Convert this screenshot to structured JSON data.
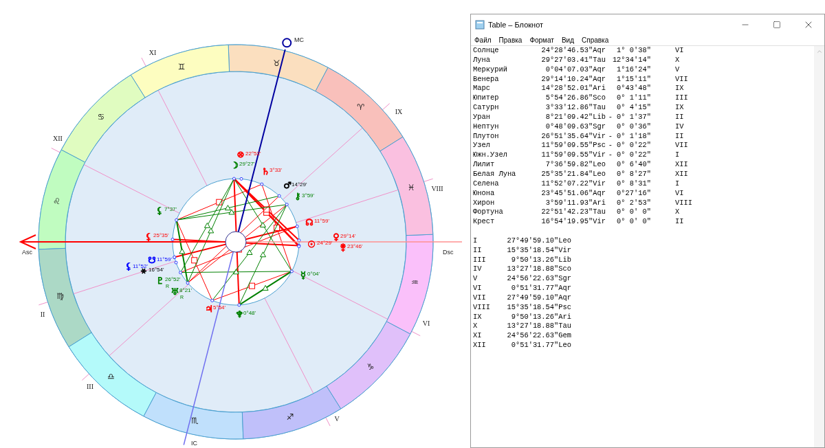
{
  "chart": {
    "signs": [
      {
        "glyph": "♈",
        "color": "#f9c0bb"
      },
      {
        "glyph": "♉",
        "color": "#fbdfbf"
      },
      {
        "glyph": "♊",
        "color": "#fdfdc0"
      },
      {
        "glyph": "♋",
        "color": "#e0fcc0"
      },
      {
        "glyph": "♌",
        "color": "#c0fcc0"
      },
      {
        "glyph": "♍",
        "color": "#acd9c6"
      },
      {
        "glyph": "♎",
        "color": "#b4fafa"
      },
      {
        "glyph": "♏",
        "color": "#c0e0fc"
      },
      {
        "glyph": "♐",
        "color": "#c0c0fa"
      },
      {
        "glyph": "♑",
        "color": "#e0c0fa"
      },
      {
        "glyph": "♒",
        "color": "#fac0fa"
      },
      {
        "glyph": "♓",
        "color": "#fac0e0"
      }
    ],
    "house_labels": [
      "XI",
      "XII",
      "II",
      "III",
      "V",
      "VI",
      "VIII",
      "IX"
    ],
    "axis_labels": [
      "Asc",
      "MC",
      "Dsc",
      "IC"
    ],
    "planets": [
      {
        "glyph": "⊗",
        "degree": "22°52'",
        "color": "#ff0000"
      },
      {
        "glyph": "☽",
        "degree": "29°27'",
        "color": "#008000"
      },
      {
        "glyph": "♄",
        "degree": "3°33'",
        "color": "#ff0000"
      },
      {
        "glyph": "♂",
        "degree": "14°29'",
        "color": "#000000"
      },
      {
        "glyph": "⚷",
        "degree": "3°59'",
        "color": "#008000"
      },
      {
        "glyph": "⚸",
        "degree": "7°37'",
        "color": "#008000"
      },
      {
        "glyph": "☊",
        "degree": "11°59'",
        "color": "#ff0000"
      },
      {
        "glyph": "⚸",
        "degree": "25°35'",
        "color": "#ff0000"
      },
      {
        "glyph": "♀",
        "degree": "29°14'",
        "color": "#ff0000"
      },
      {
        "glyph": "☉",
        "degree": "24°29'",
        "color": "#ff0000"
      },
      {
        "glyph": "⚵",
        "degree": "23°46'",
        "color": "#ff0000"
      },
      {
        "glyph": "☋",
        "degree": "11°59'",
        "color": "#0000ff"
      },
      {
        "glyph": "⚸",
        "degree": "11°52'",
        "color": "#0000ff"
      },
      {
        "glyph": "⚹",
        "degree": "16°54'",
        "color": "#000000"
      },
      {
        "glyph": "☿",
        "degree": "0°04'",
        "color": "#008000"
      },
      {
        "glyph": "♇",
        "degree": "26°52'",
        "color": "#008000",
        "retro": "R"
      },
      {
        "glyph": "♅",
        "degree": "8°21'",
        "color": "#008000",
        "retro": "R"
      },
      {
        "glyph": "♃",
        "degree": "5°54'",
        "color": "#ff0000"
      },
      {
        "glyph": "♆",
        "degree": "0°48'",
        "color": "#008000"
      }
    ]
  },
  "notepad": {
    "title": "Table – Блокнот",
    "menu": [
      "Файл",
      "Правка",
      "Формат",
      "Вид",
      "Справка"
    ],
    "planet_rows": [
      {
        "name": "Солнце",
        "position": "24°28'46.53\"Aqr",
        "motion": "1° 0'38\"",
        "house": "VI"
      },
      {
        "name": "Луна",
        "position": "29°27'03.41\"Tau",
        "motion": "12°34'14\"",
        "house": "X"
      },
      {
        "name": "Меркурий",
        "position": "0°04'07.03\"Aqr",
        "motion": "1°16'24\"",
        "house": "V"
      },
      {
        "name": "Венера",
        "position": "29°14'10.24\"Aqr",
        "motion": "1°15'11\"",
        "house": "VII"
      },
      {
        "name": "Марс",
        "position": "14°28'52.01\"Ari",
        "motion": "0°43'48\"",
        "house": "IX"
      },
      {
        "name": "Юпитер",
        "position": "5°54'26.86\"Sco",
        "motion": "0° 1'11\"",
        "house": "III"
      },
      {
        "name": "Сатурн",
        "position": "3°33'12.86\"Tau",
        "motion": "0° 4'15\"",
        "house": "IX"
      },
      {
        "name": "Уран",
        "position": "8°21'09.42\"Lib",
        "motion": "- 0° 1'37\"",
        "house": "II"
      },
      {
        "name": "Нептун",
        "position": "0°48'09.63\"Sgr",
        "motion": "0° 0'36\"",
        "house": "IV"
      },
      {
        "name": "Плутон",
        "position": "26°51'35.64\"Vir",
        "motion": "- 0° 1'18\"",
        "house": "II"
      },
      {
        "name": "Узел",
        "position": "11°59'09.55\"Psc",
        "motion": "- 0° 0'22\"",
        "house": "VII"
      },
      {
        "name": "Южн.Узел",
        "position": "11°59'09.55\"Vir",
        "motion": "- 0° 0'22\"",
        "house": "I"
      },
      {
        "name": "Лилит",
        "position": "7°36'59.82\"Leo",
        "motion": "0° 6'40\"",
        "house": "XII"
      },
      {
        "name": "Белая Луна",
        "position": "25°35'21.84\"Leo",
        "motion": "0° 8'27\"",
        "house": "XII"
      },
      {
        "name": "Селена",
        "position": "11°52'07.22\"Vir",
        "motion": "0° 8'31\"",
        "house": "I"
      },
      {
        "name": "Юнона",
        "position": "23°45'51.06\"Aqr",
        "motion": "0°27'16\"",
        "house": "VI"
      },
      {
        "name": "Хирон",
        "position": "3°59'11.93\"Ari",
        "motion": "0° 2'53\"",
        "house": "VIII"
      },
      {
        "name": "Фортуна",
        "position": "22°51'42.23\"Tau",
        "motion": "0° 0' 0\"",
        "house": "X"
      },
      {
        "name": "Крест",
        "position": "16°54'19.95\"Vir",
        "motion": "0° 0' 0\"",
        "house": "II"
      }
    ],
    "house_rows": [
      {
        "house": "I",
        "position": "27°49'59.10\"Leo"
      },
      {
        "house": "II",
        "position": "15°35'18.54\"Vir"
      },
      {
        "house": "III",
        "position": "9°50'13.26\"Lib"
      },
      {
        "house": "IV",
        "position": "13°27'18.88\"Sco"
      },
      {
        "house": "V",
        "position": "24°56'22.63\"Sgr"
      },
      {
        "house": "VI",
        "position": "0°51'31.77\"Aqr"
      },
      {
        "house": "VII",
        "position": "27°49'59.10\"Aqr"
      },
      {
        "house": "VIII",
        "position": "15°35'18.54\"Psc"
      },
      {
        "house": "IX",
        "position": "9°50'13.26\"Ari"
      },
      {
        "house": "X",
        "position": "13°27'18.88\"Tau"
      },
      {
        "house": "XI",
        "position": "24°56'22.63\"Gem"
      },
      {
        "house": "XII",
        "position": "0°51'31.77\"Leo"
      }
    ]
  }
}
